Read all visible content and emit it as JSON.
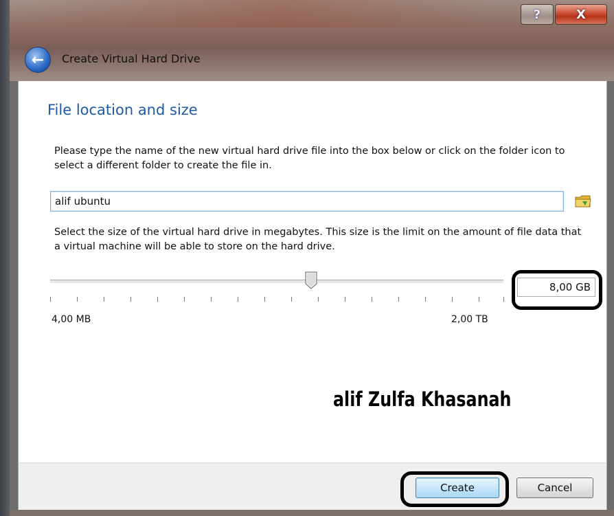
{
  "window": {
    "title": "Create Virtual Hard Drive",
    "help_label": "?",
    "close_label": "X"
  },
  "page": {
    "heading": "File location and size",
    "location_description": "Please type the name of the new virtual hard drive file into the box below or click on the folder icon to select a different folder to create the file in.",
    "file_name_value": "alif ubuntu",
    "size_description": "Select the size of the virtual hard drive in megabytes. This size is the limit on the amount of file data that a virtual machine will be able to store on the hard drive.",
    "size_value": "8,00 GB",
    "slider_min_label": "4,00 MB",
    "slider_max_label": "2,00 TB",
    "slider_position_fraction": 0.57
  },
  "watermark": "alif Zulfa Khasanah",
  "buttons": {
    "create": "Create",
    "cancel": "Cancel"
  },
  "icons": {
    "back": "back-arrow-icon",
    "folder": "folder-icon"
  }
}
